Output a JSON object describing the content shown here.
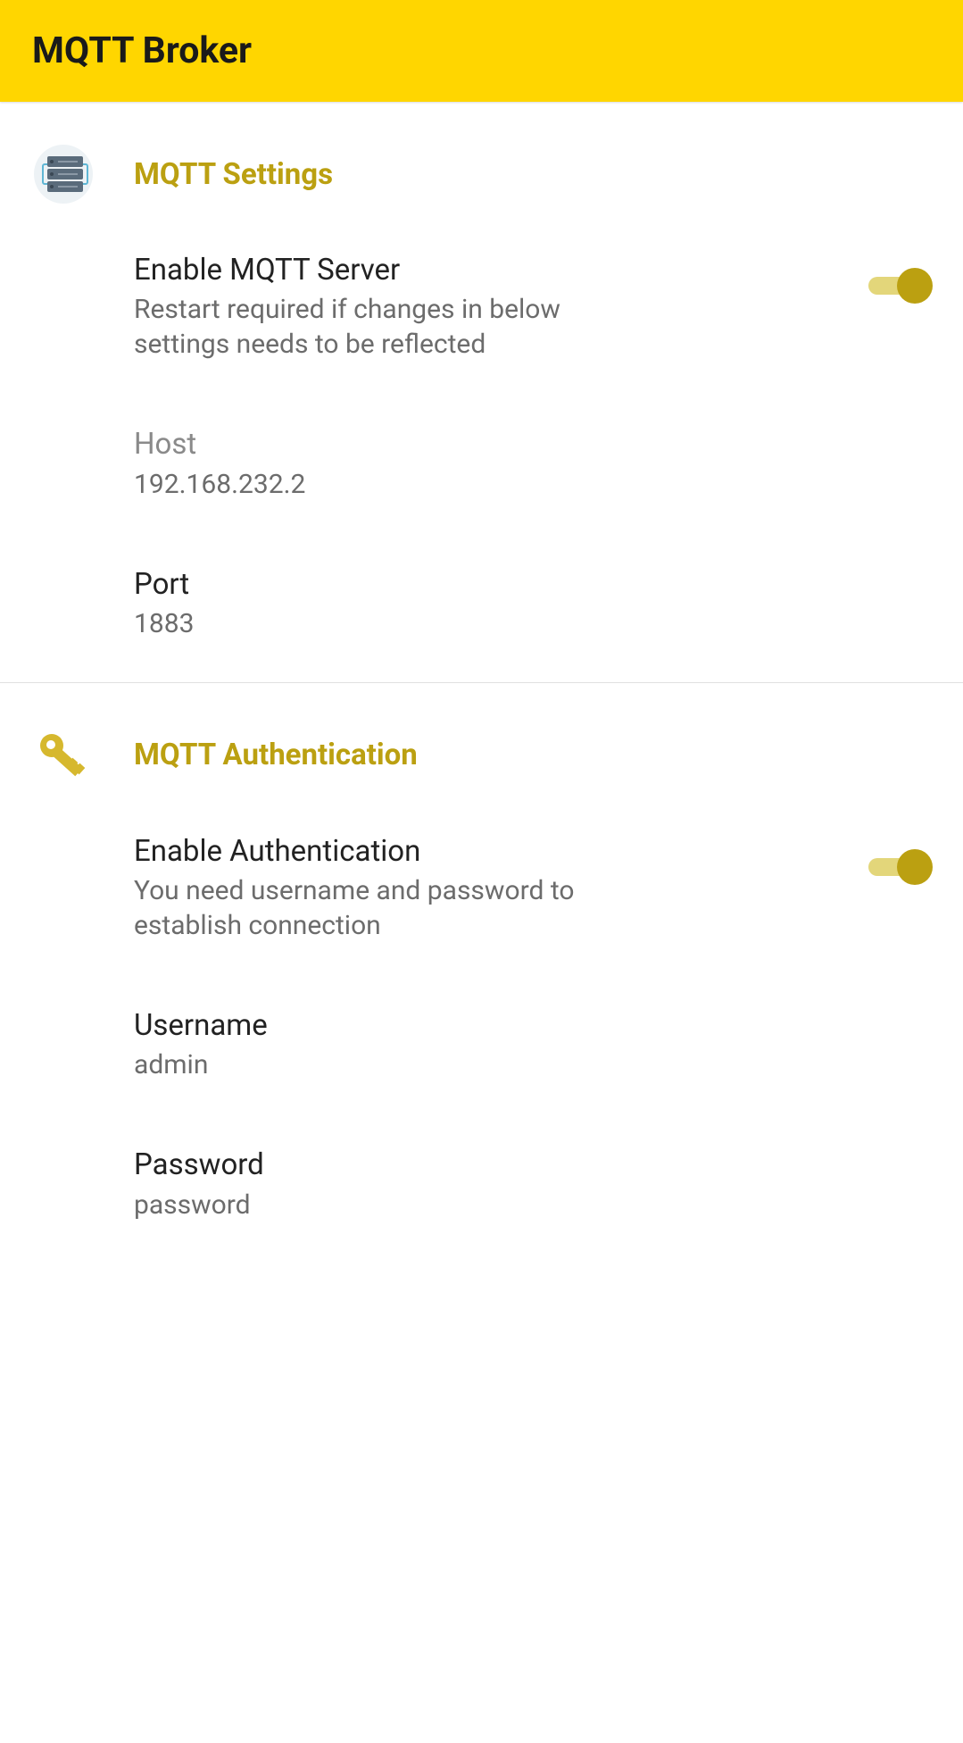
{
  "header": {
    "title": "MQTT Broker"
  },
  "settings": {
    "title": "MQTT Settings",
    "enable": {
      "title": "Enable MQTT Server",
      "sub": "Restart required if changes in below settings needs to be reflected",
      "on": true
    },
    "host": {
      "label": "Host",
      "value": "192.168.232.2"
    },
    "port": {
      "label": "Port",
      "value": "1883"
    }
  },
  "auth": {
    "title": "MQTT Authentication",
    "enable": {
      "title": "Enable Authentication",
      "sub": "You need username and password to establish connection",
      "on": true
    },
    "username": {
      "label": "Username",
      "value": "admin"
    },
    "password": {
      "label": "Password",
      "value": "password"
    }
  }
}
